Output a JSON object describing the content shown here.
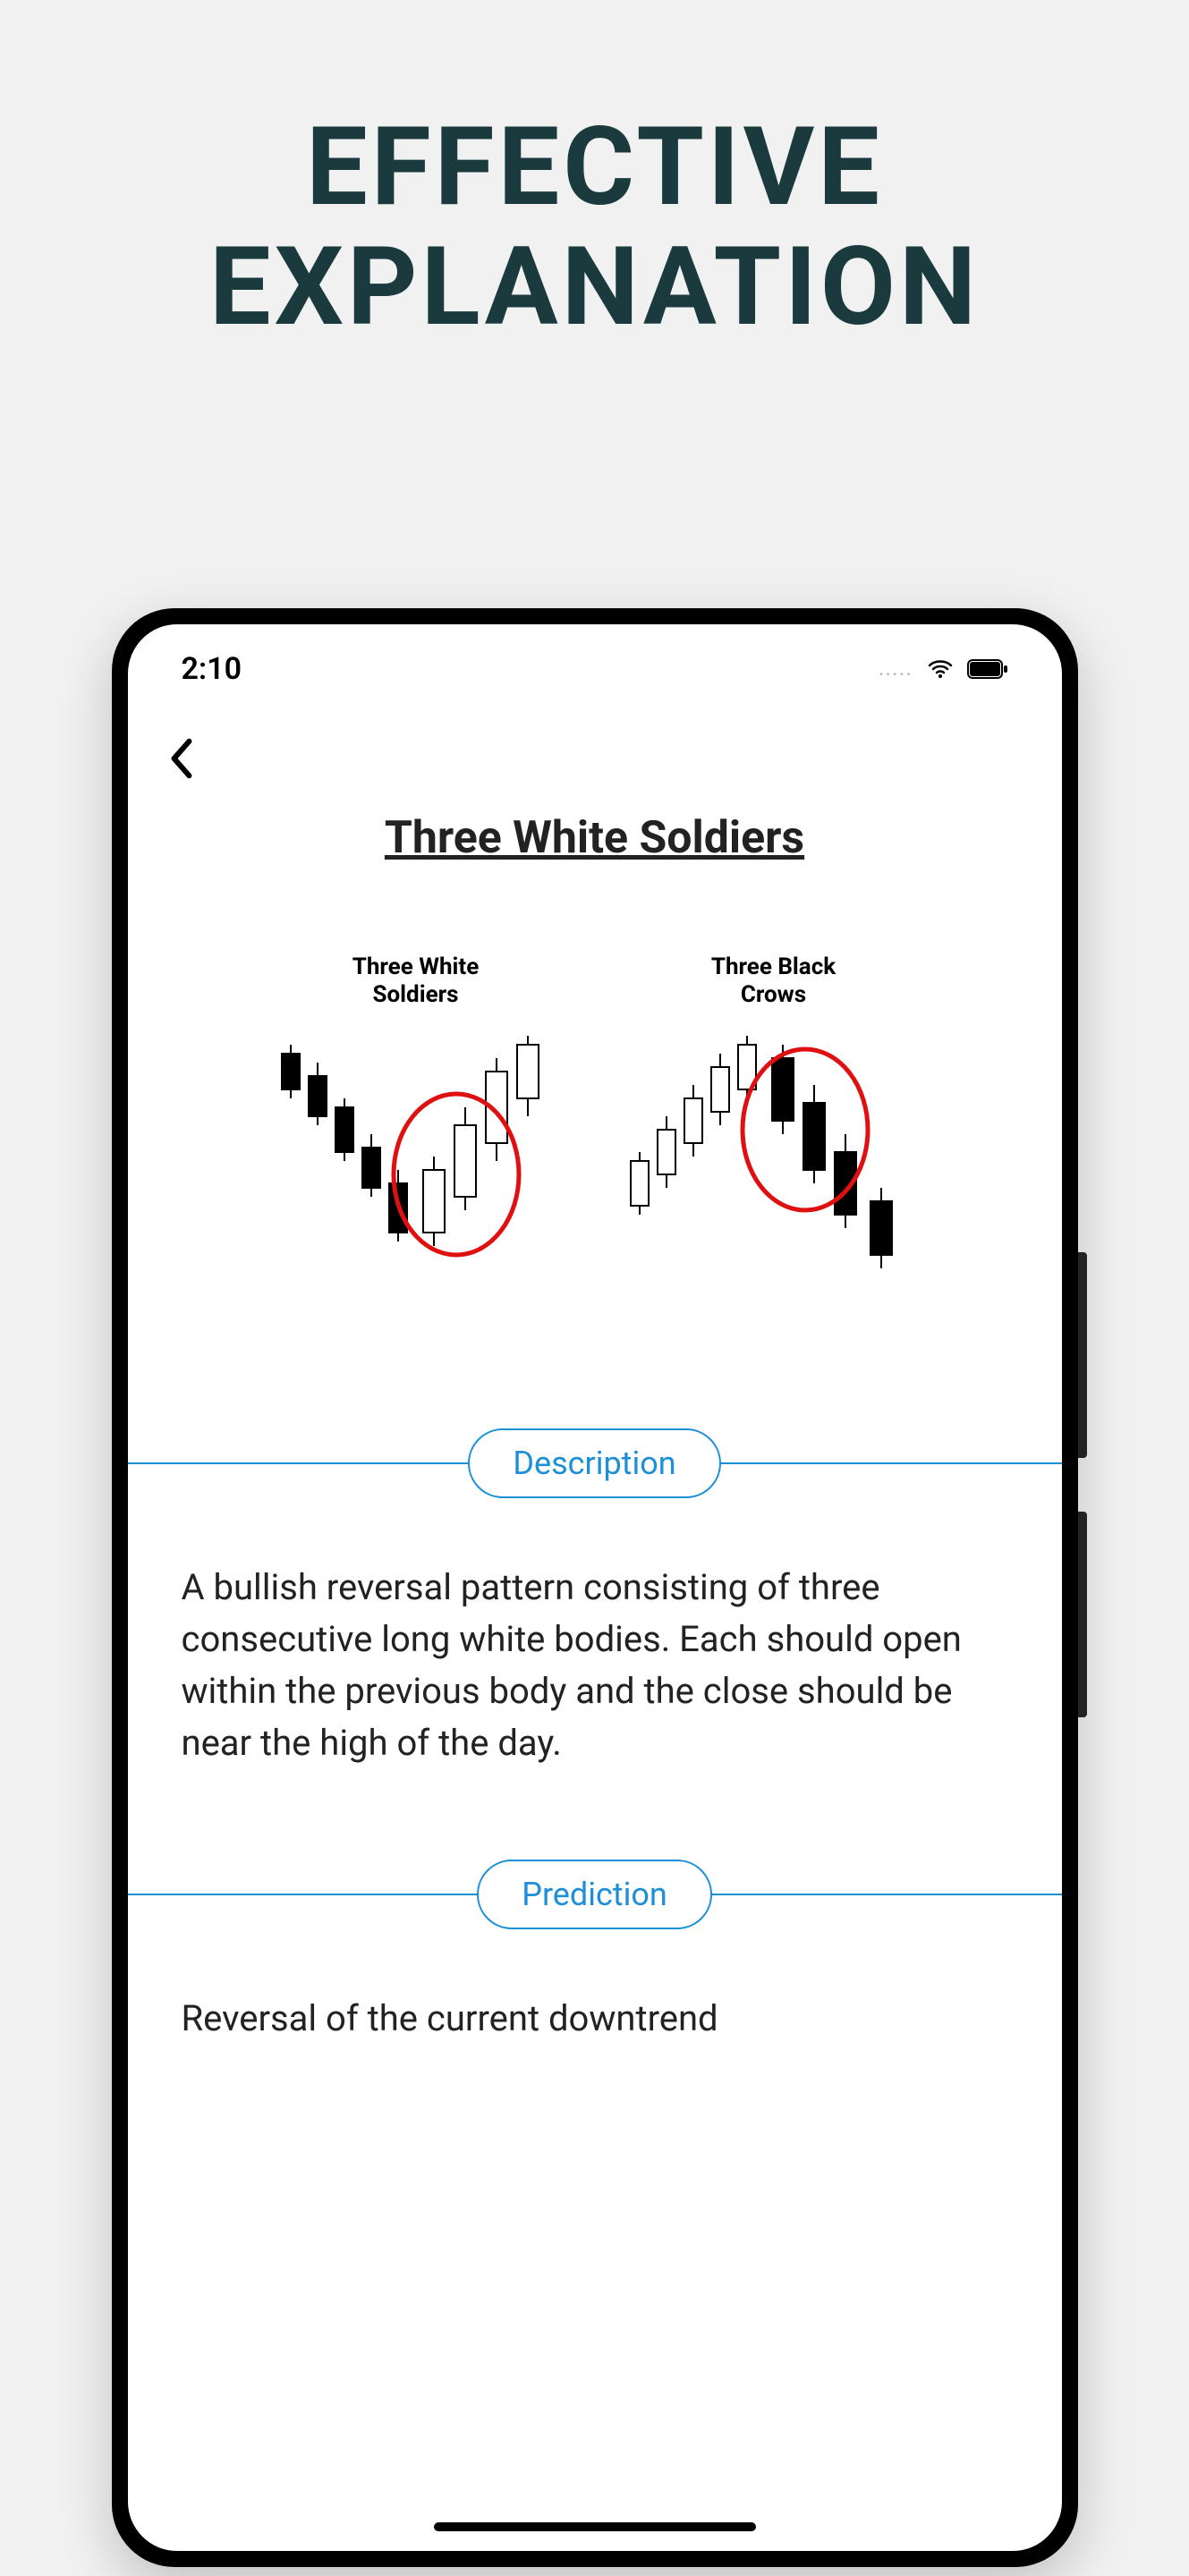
{
  "headline_line1": "EFFECTIVE",
  "headline_line2": "EXPLANATION",
  "status": {
    "time": "2:10",
    "dots": "....."
  },
  "page": {
    "title": "Three White Soldiers"
  },
  "illustration": {
    "left_label_line1": "Three White",
    "left_label_line2": "Soldiers",
    "right_label_line1": "Three Black",
    "right_label_line2": "Crows"
  },
  "sections": {
    "description_label": "Description",
    "description_text": "A bullish reversal pattern consisting of three consecutive long white bodies. Each should open within the previous body and the close should be near the high of the day.",
    "prediction_label": "Prediction",
    "prediction_text": "Reversal of the current downtrend"
  }
}
